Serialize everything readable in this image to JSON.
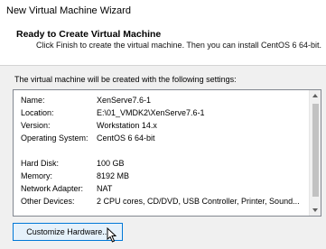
{
  "window": {
    "title": "New Virtual Machine Wizard"
  },
  "header": {
    "title": "Ready to Create Virtual Machine",
    "description": "Click Finish to create the virtual machine. Then you can install CentOS 6 64-bit."
  },
  "main": {
    "intro": "The virtual machine will be created with the following settings:",
    "settings": [
      {
        "label": "Name:",
        "value": "XenServe7.6-1"
      },
      {
        "label": "Location:",
        "value": "E:\\01_VMDK2\\XenServe7.6-1"
      },
      {
        "label": "Version:",
        "value": "Workstation 14.x"
      },
      {
        "label": "Operating System:",
        "value": "CentOS 6 64-bit"
      },
      {
        "label": "Hard Disk:",
        "value": "100 GB"
      },
      {
        "label": "Memory:",
        "value": "8192 MB"
      },
      {
        "label": "Network Adapter:",
        "value": "NAT"
      },
      {
        "label": "Other Devices:",
        "value": "2 CPU cores, CD/DVD, USB Controller, Printer, Sound..."
      }
    ]
  },
  "buttons": {
    "customize_hardware": "Customize Hardware..."
  },
  "icons": {
    "scroll_up": "scroll-up-arrow",
    "scroll_down": "scroll-down-arrow",
    "cursor": "mouse-pointer"
  }
}
